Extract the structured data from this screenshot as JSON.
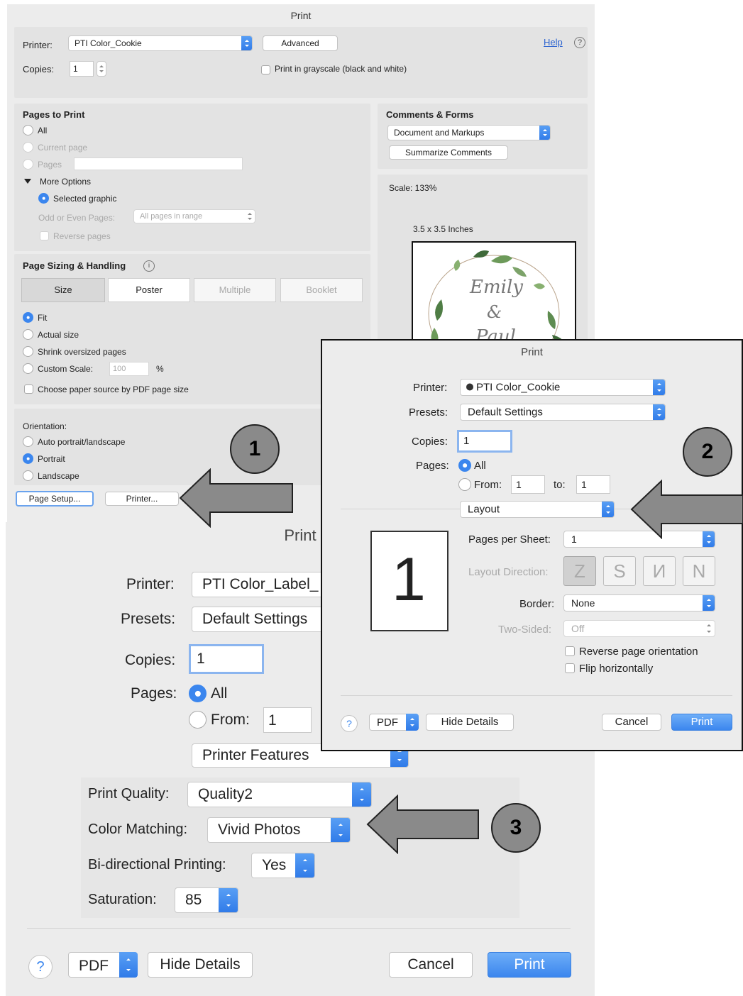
{
  "dialog1": {
    "title": "Print",
    "printer_label": "Printer:",
    "printer_value": "PTI Color_Cookie",
    "advanced_button": "Advanced",
    "help_link": "Help",
    "copies_label": "Copies:",
    "copies_value": "1",
    "grayscale_label": "Print in grayscale (black and white)",
    "pages_to_print": {
      "heading": "Pages to Print",
      "all": "All",
      "current_page": "Current page",
      "pages": "Pages",
      "more_options": "More Options",
      "selected_graphic": "Selected graphic",
      "odd_even_label": "Odd or Even Pages:",
      "odd_even_value": "All pages in range",
      "reverse_pages": "Reverse pages"
    },
    "comments_forms": {
      "heading": "Comments & Forms",
      "value": "Document and Markups",
      "summarize_button": "Summarize Comments"
    },
    "preview": {
      "scale": "Scale: 133%",
      "size": "3.5 x 3.5 Inches",
      "line1": "Emily",
      "line2": "&",
      "line3": "Paul"
    },
    "page_sizing": {
      "heading": "Page Sizing & Handling",
      "tabs": [
        "Size",
        "Poster",
        "Multiple",
        "Booklet"
      ],
      "fit": "Fit",
      "actual_size": "Actual size",
      "shrink": "Shrink oversized pages",
      "custom_scale_label": "Custom Scale:",
      "custom_scale_value": "100",
      "percent": "%",
      "paper_source": "Choose paper source by PDF page size"
    },
    "orientation": {
      "heading": "Orientation:",
      "auto": "Auto portrait/landscape",
      "portrait": "Portrait",
      "landscape": "Landscape"
    },
    "page_setup_button": "Page Setup...",
    "printer_button": "Printer..."
  },
  "dialog2": {
    "title": "Print",
    "printer_label": "Printer:",
    "printer_value": "PTI Color_Cookie",
    "presets_label": "Presets:",
    "presets_value": "Default Settings",
    "copies_label": "Copies:",
    "copies_value": "1",
    "pages_label": "Pages:",
    "all": "All",
    "from_label": "From:",
    "from_value": "1",
    "to_label": "to:",
    "to_value": "1",
    "section_value": "Layout",
    "preview_number": "1",
    "pages_per_sheet_label": "Pages per Sheet:",
    "pages_per_sheet_value": "1",
    "layout_direction_label": "Layout Direction:",
    "border_label": "Border:",
    "border_value": "None",
    "two_sided_label": "Two-Sided:",
    "two_sided_value": "Off",
    "reverse_orientation": "Reverse page orientation",
    "flip_horizontally": "Flip horizontally",
    "help": "?",
    "pdf": "PDF",
    "hide_details": "Hide Details",
    "cancel": "Cancel",
    "print": "Print"
  },
  "dialog3": {
    "title": "Print",
    "printer_label": "Printer:",
    "printer_value": "PTI Color_Label_",
    "presets_label": "Presets:",
    "presets_value": "Default Settings",
    "copies_label": "Copies:",
    "copies_value": "1",
    "pages_label": "Pages:",
    "all": "All",
    "from_label": "From:",
    "from_value": "1",
    "section_value": "Printer Features",
    "print_quality_label": "Print Quality:",
    "print_quality_value": "Quality2",
    "color_matching_label": "Color Matching:",
    "color_matching_value": "Vivid Photos",
    "bidirectional_label": "Bi-directional Printing:",
    "bidirectional_value": "Yes",
    "saturation_label": "Saturation:",
    "saturation_value": "85",
    "help": "?",
    "pdf": "PDF",
    "hide_details": "Hide Details",
    "cancel": "Cancel",
    "print": "Print"
  },
  "callouts": [
    "1",
    "2",
    "3"
  ],
  "colors": {
    "accent": "#3b86ee",
    "window_bg": "#ececec",
    "panel_bg": "#e3e3e3",
    "arrow_fill": "#8a8a8a"
  }
}
